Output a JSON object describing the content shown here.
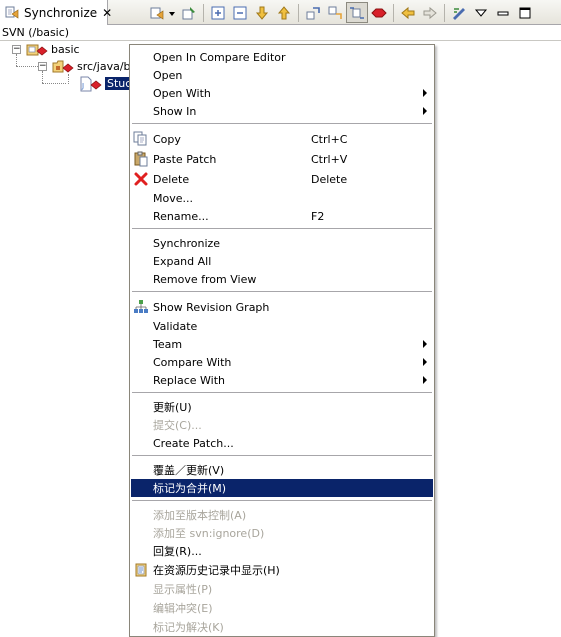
{
  "view": {
    "tab_label": "Synchronize",
    "close_glyph": "✕",
    "scope_label": "SVN (/basic)"
  },
  "toolbar": {
    "buttons": [
      "sync-view-dropdown",
      "pin-icon",
      "expand-all-icon",
      "collapse-all-icon",
      "next-icon",
      "previous-icon",
      "incoming-mode-icon",
      "outgoing-mode-icon",
      "both-mode-icon",
      "conflicts-mode-icon",
      "back-icon",
      "forward-icon",
      "preferences-icon",
      "view-menu-icon"
    ]
  },
  "tree": {
    "items": [
      {
        "label": "basic",
        "expander": "−"
      },
      {
        "label": "src/java/b",
        "expander": "−"
      },
      {
        "label": "Stuc"
      }
    ]
  },
  "menu": {
    "items": [
      {
        "label": "Open In Compare Editor"
      },
      {
        "label": "Open"
      },
      {
        "label": "Open With"
      },
      {
        "label": "Show In"
      },
      {
        "label": "Copy",
        "accel": "Ctrl+C"
      },
      {
        "label": "Paste Patch",
        "accel": "Ctrl+V"
      },
      {
        "label": "Delete",
        "accel": "Delete"
      },
      {
        "label": "Move..."
      },
      {
        "label": "Rename...",
        "accel": "F2"
      },
      {
        "label": "Synchronize"
      },
      {
        "label": "Expand All"
      },
      {
        "label": "Remove from View"
      },
      {
        "label": "Show Revision Graph"
      },
      {
        "label": "Validate"
      },
      {
        "label": "Team"
      },
      {
        "label": "Compare With"
      },
      {
        "label": "Replace With"
      },
      {
        "label": "更新(U)"
      },
      {
        "label": "提交(C)..."
      },
      {
        "label": "Create Patch..."
      },
      {
        "label": "覆盖／更新(V)"
      },
      {
        "label": "标记为合并(M)"
      },
      {
        "label": "添加至版本控制(A)"
      },
      {
        "label": "添加至 svn:ignore(D)"
      },
      {
        "label": "回复(R)..."
      },
      {
        "label": "在资源历史记录中显示(H)"
      },
      {
        "label": "显示属性(P)"
      },
      {
        "label": "编辑冲突(E)"
      },
      {
        "label": "标记为解决(K)"
      }
    ]
  },
  "colors": {
    "highlight": "#0a246a",
    "disabled_text": "#a8a59c",
    "delete_icon": "#e02020"
  }
}
